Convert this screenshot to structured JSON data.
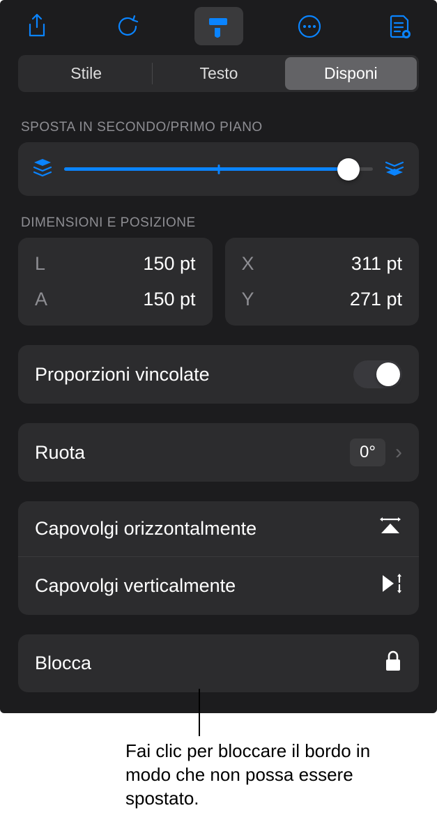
{
  "toolbar": {
    "icons": [
      "share-icon",
      "undo-icon",
      "format-brush-icon",
      "more-icon",
      "page-preview-icon"
    ]
  },
  "tabs": {
    "style": "Stile",
    "text": "Testo",
    "arrange": "Disponi"
  },
  "move_section": {
    "title": "SPOSTA IN SECONDO/PRIMO PIANO"
  },
  "size_pos": {
    "title": "DIMENSIONI E POSIZIONE",
    "width_label": "L",
    "width_value": "150 pt",
    "height_label": "A",
    "height_value": "150 pt",
    "x_label": "X",
    "x_value": "311 pt",
    "y_label": "Y",
    "y_value": "271 pt"
  },
  "constrain": {
    "label": "Proporzioni vincolate"
  },
  "rotate": {
    "label": "Ruota",
    "value": "0°"
  },
  "flip_h": {
    "label": "Capovolgi orizzontalmente"
  },
  "flip_v": {
    "label": "Capovolgi verticalmente"
  },
  "lock": {
    "label": "Blocca"
  },
  "callout": "Fai clic per bloccare il bordo in modo che non possa essere spostato."
}
